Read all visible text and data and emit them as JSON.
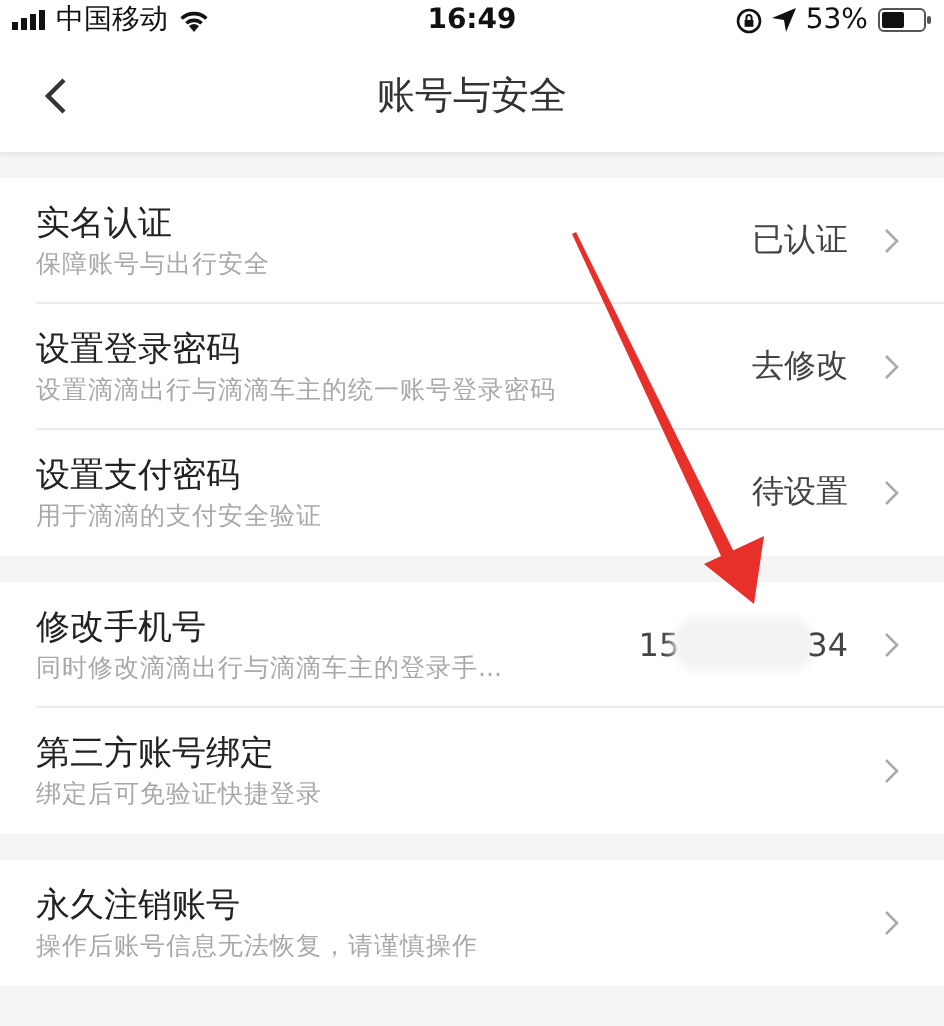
{
  "status_bar": {
    "carrier": "中国移动",
    "time": "16:49",
    "battery": "53%"
  },
  "nav": {
    "title": "账号与安全"
  },
  "groups": [
    {
      "rows": [
        {
          "kind": "text",
          "title": "实名认证",
          "subtitle": "保障账号与出行安全",
          "value": "已认证"
        },
        {
          "kind": "text",
          "title": "设置登录密码",
          "subtitle": "设置滴滴出行与滴滴车主的统一账号登录密码",
          "value": "去修改"
        },
        {
          "kind": "text",
          "title": "设置支付密码",
          "subtitle": "用于滴滴的支付安全验证",
          "value": "待设置"
        }
      ]
    },
    {
      "rows": [
        {
          "kind": "redacted",
          "title": "修改手机号",
          "subtitle": "同时修改滴滴出行与滴滴车主的登录手...",
          "value_start": "15",
          "value_end": "34"
        },
        {
          "kind": "none",
          "title": "第三方账号绑定",
          "subtitle": "绑定后可免验证快捷登录"
        }
      ]
    },
    {
      "rows": [
        {
          "kind": "none",
          "title": "永久注销账号",
          "subtitle": "操作后账号信息无法恢复，请谨慎操作"
        }
      ]
    }
  ]
}
